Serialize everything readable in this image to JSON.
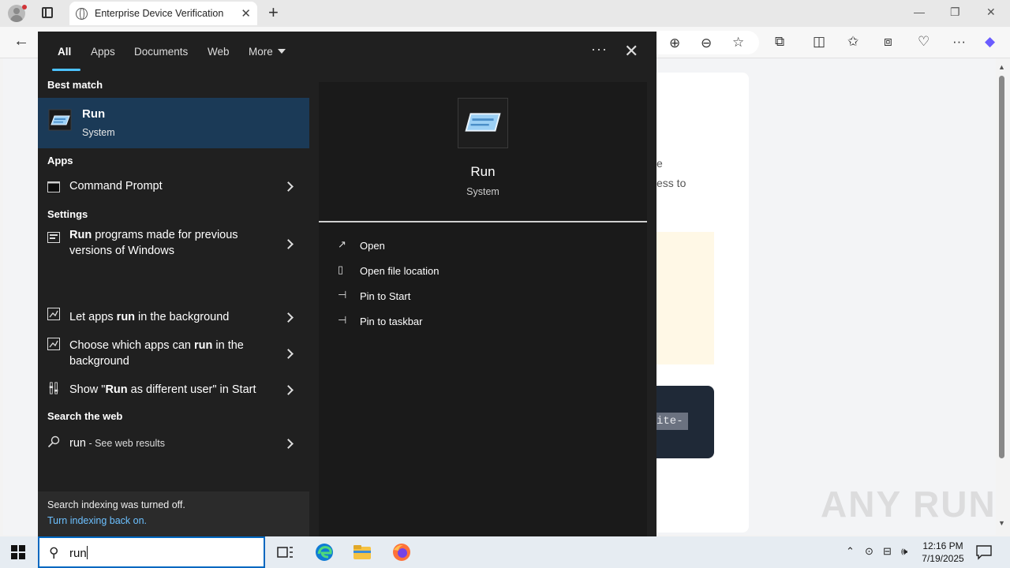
{
  "browser": {
    "tab_title": "Enterprise Device Verification",
    "page_fragments": {
      "line1": "e",
      "line2": "ess to",
      "code": "ite-"
    },
    "watermark": "ANY RUN"
  },
  "search": {
    "filters": [
      "All",
      "Apps",
      "Documents",
      "Web",
      "More"
    ],
    "active_filter": "All",
    "sections": {
      "best_match": "Best match",
      "apps": "Apps",
      "settings": "Settings",
      "web": "Search the web"
    },
    "best_match": {
      "name": "Run",
      "type": "System"
    },
    "apps": [
      {
        "label": "Command Prompt"
      }
    ],
    "settings": [
      {
        "bold": "Run",
        "rest": " programs made for previous versions of Windows"
      },
      {
        "pre": "Let apps ",
        "bold": "run",
        "rest": " in the background"
      },
      {
        "pre": "Choose which apps can ",
        "bold": "run",
        "rest": " in the background"
      },
      {
        "pre": "Show \"",
        "bold": "Run",
        "rest": " as different user\" in Start"
      }
    ],
    "web": {
      "query": "run",
      "suffix": " - See web results"
    },
    "indexing": {
      "notice": "Search indexing was turned off.",
      "link": "Turn indexing back on."
    },
    "preview": {
      "name": "Run",
      "type": "System",
      "actions": [
        "Open",
        "Open file location",
        "Pin to Start",
        "Pin to taskbar"
      ]
    }
  },
  "taskbar": {
    "search_text": "run",
    "time": "12:16 PM",
    "date": "7/19/2025"
  },
  "colors": {
    "panel_bg": "#202020",
    "best_match_bg": "#1b3a57",
    "accent": "#4cc2ff",
    "link": "#6cc0ff",
    "taskbar_bg": "#e6ecf2"
  }
}
